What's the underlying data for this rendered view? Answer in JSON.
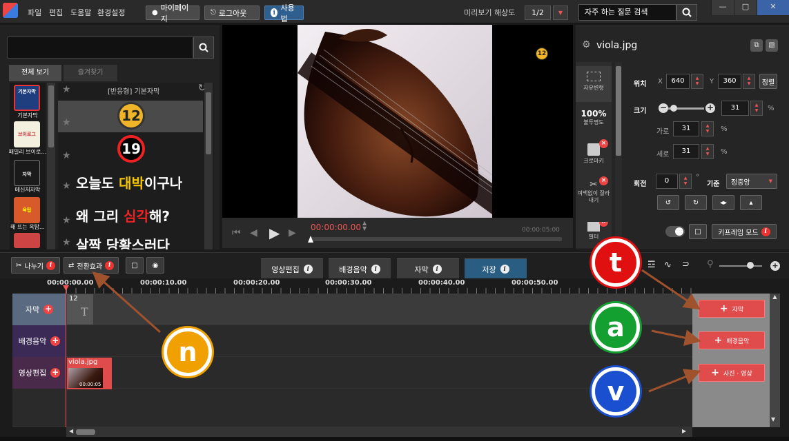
{
  "menu": [
    "파일",
    "편집",
    "도움말",
    "환경설정"
  ],
  "top_buttons": {
    "mypage": "마이페이지",
    "logout": "로그아웃",
    "howto": "사용법"
  },
  "preview_resolution": {
    "label": "미리보기 해상도",
    "value": "1/2"
  },
  "faq_search": {
    "placeholder": "자주 하는 질문 검색"
  },
  "left_panel": {
    "tabs": [
      "전체 보기",
      "즐겨찾기"
    ],
    "thumbs": [
      {
        "label": "기본자막",
        "badge": "반응형",
        "text": "기본자막"
      },
      {
        "label": "패밀리 브이로…",
        "badge": "반응형",
        "text": "브이로그"
      },
      {
        "label": "메신저자막",
        "badge": "반응형",
        "text": "자막"
      },
      {
        "label": "해 뜨는 옥탑…",
        "badge": "반응형",
        "text": "옥탑"
      },
      {
        "label": "",
        "badge": "반응형",
        "text": ""
      }
    ],
    "list_title": "[반응형] 기본자막",
    "items": [
      {
        "type": "badge",
        "text": "12"
      },
      {
        "type": "badge",
        "text": "19"
      },
      {
        "type": "caption",
        "pre": "오늘도 ",
        "hl": "대박",
        "post": "이구나"
      },
      {
        "type": "caption",
        "pre": "왜 그리 ",
        "hl": "심각",
        "post": "해?"
      },
      {
        "type": "caption",
        "pre": "",
        "hl": "",
        "post": "살짝 당황스러다"
      }
    ]
  },
  "preview": {
    "overlay_badge": "12",
    "current_time": "00:00:00.00",
    "total_time": "00:00:05:00"
  },
  "properties": {
    "filename": "viola.jpg",
    "position": {
      "label": "위치",
      "x_label": "X",
      "x": "640",
      "y_label": "Y",
      "y": "360",
      "align_btn": "정렬"
    },
    "size": {
      "label": "크기",
      "value": "31",
      "unit": "%",
      "slider_fraction": 0.05
    },
    "width": {
      "label": "가로",
      "value": "31",
      "unit": "%"
    },
    "height": {
      "label": "세로",
      "value": "31",
      "unit": "%"
    },
    "rotation": {
      "label": "회전",
      "value": "0",
      "unit": "°",
      "basis_label": "기준",
      "basis": "정중앙"
    },
    "keyframe_btn": "키프레임 모드",
    "side_items": [
      "자유변형",
      "100%",
      "불투명도",
      "크로마키",
      "여백없이 잘라내기",
      "필터"
    ]
  },
  "toolbar": {
    "split": "나누기",
    "transition": "전환효과",
    "tabs": [
      "영상편집",
      "배경음악",
      "자막",
      "저장"
    ],
    "active_tab": "저장"
  },
  "timeline": {
    "ticks": [
      "00:00:00.00",
      "00:00:10.00",
      "00:00:20.00",
      "00:00:30.00",
      "00:00:40.00",
      "00:00:50.00"
    ],
    "tracks": [
      "자막",
      "배경음악",
      "영상편집"
    ],
    "subtitle_clip": {
      "label": "12",
      "icon": "T"
    },
    "video_clip": {
      "label": "viola.jpg",
      "duration": "00:00:05"
    },
    "add_buttons": [
      "자막",
      "배경음악",
      "사진 · 영상"
    ]
  },
  "annotations": [
    "t",
    "a",
    "v",
    "n"
  ],
  "colors": {
    "accent_red": "#e04b4b",
    "active_tab": "#2a5d82",
    "badge_yellow": "#f0b428"
  }
}
